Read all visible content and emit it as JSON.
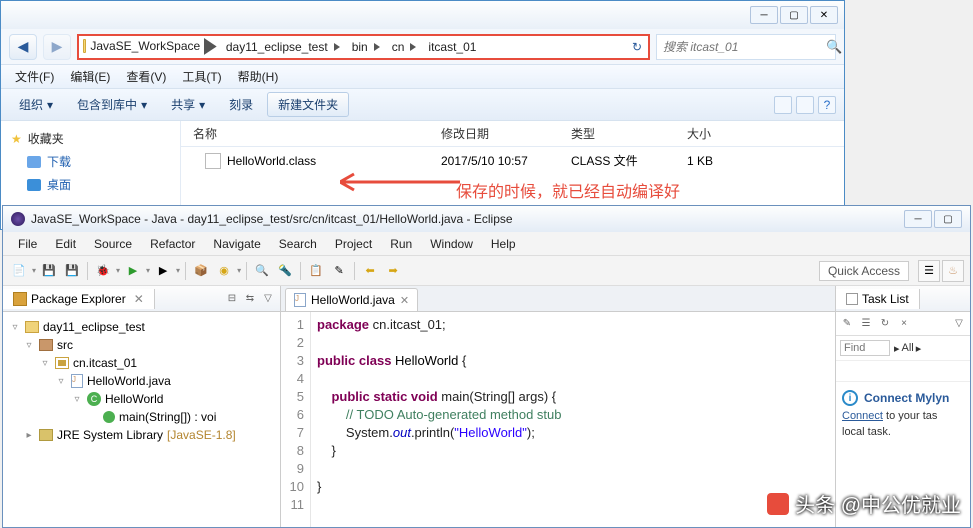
{
  "explorer": {
    "breadcrumb_root": "JavaSE_WorkSpace",
    "breadcrumb": [
      "day11_eclipse_test",
      "bin",
      "cn",
      "itcast_01"
    ],
    "search_placeholder": "搜索 itcast_01",
    "menu": {
      "file": "文件(F)",
      "edit": "编辑(E)",
      "view": "查看(V)",
      "tools": "工具(T)",
      "help": "帮助(H)"
    },
    "toolbar": {
      "organize": "组织",
      "include": "包含到库中",
      "share": "共享",
      "burn": "刻录",
      "newfolder": "新建文件夹"
    },
    "side": {
      "fav": "收藏夹",
      "downloads": "下载",
      "desktop": "桌面"
    },
    "headers": {
      "name": "名称",
      "modified": "修改日期",
      "type": "类型",
      "size": "大小"
    },
    "file": {
      "name": "HelloWorld.class",
      "modified": "2017/5/10 10:57",
      "type": "CLASS 文件",
      "size": "1 KB"
    }
  },
  "annotation": "保存的时候，就已经自动编译好",
  "eclipse": {
    "title": "JavaSE_WorkSpace - Java - day11_eclipse_test/src/cn/itcast_01/HelloWorld.java - Eclipse",
    "menu": {
      "file": "File",
      "edit": "Edit",
      "source": "Source",
      "refactor": "Refactor",
      "navigate": "Navigate",
      "search": "Search",
      "project": "Project",
      "run": "Run",
      "window": "Window",
      "help": "Help"
    },
    "quick_access": "Quick Access",
    "pkg_explorer_title": "Package Explorer",
    "tree": {
      "project": "day11_eclipse_test",
      "src": "src",
      "pkg": "cn.itcast_01",
      "java": "HelloWorld.java",
      "cls": "HelloWorld",
      "method": "main(String[]) : voi",
      "jre": "JRE System Library",
      "jre_deco": "[JavaSE-1.8]"
    },
    "editor_tab": "HelloWorld.java",
    "code_lines": [
      "1",
      "2",
      "3",
      "4",
      "5",
      "6",
      "7",
      "8",
      "9",
      "10",
      "11"
    ],
    "task_title": "Task List",
    "find_label": "Find",
    "all_label": "All",
    "mylyn_title": "Connect Mylyn",
    "mylyn_link": "Connect",
    "mylyn_text1": " to your tas",
    "mylyn_text2": "local task."
  },
  "watermark": "头条 @中公优就业"
}
